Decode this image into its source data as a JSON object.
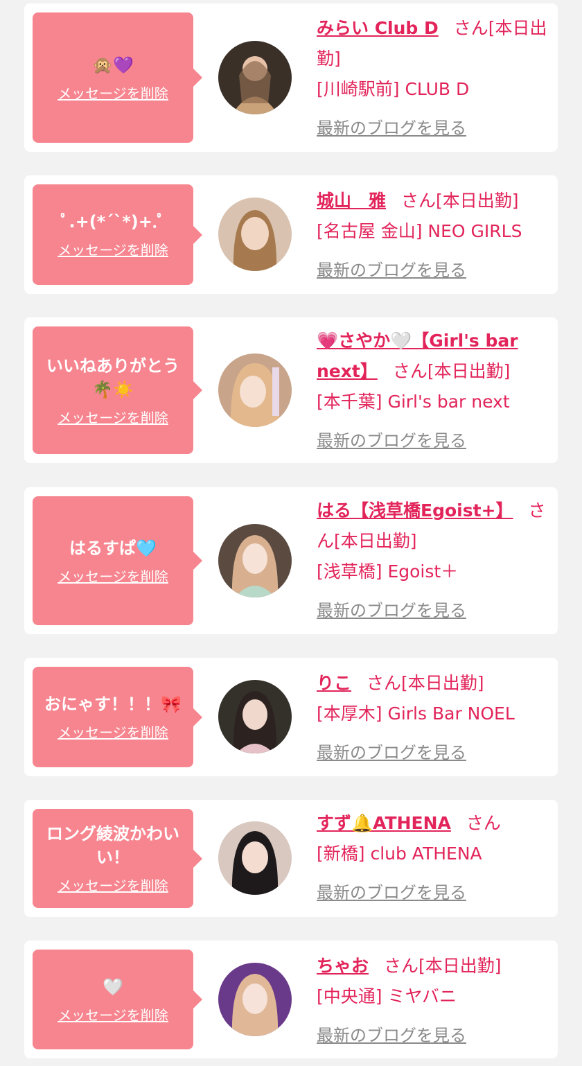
{
  "common": {
    "delete_label": "メッセージを削除",
    "blog_label": "最新のブログを見る",
    "honorific": "さん"
  },
  "colors": {
    "accent": "#e2245a",
    "bubble": "#f7858f",
    "blog_link": "#8a8a8a",
    "card": "#ffffff",
    "page": "#f2f2f3"
  },
  "items": [
    {
      "message": "🙊💜",
      "name": "みらい Club D",
      "status": "[本日出勤]",
      "shop": "[川崎駅前] CLUB D"
    },
    {
      "message": "ﾟ.+(*´`*)+.ﾟ",
      "name": "城山　雅",
      "status": "[本日出勤]",
      "shop": "[名古屋 金山] NEO GIRLS"
    },
    {
      "message": "いいねありがとう🌴☀️",
      "name": "💗さやか🤍【Girl's bar next】",
      "status": "[本日出勤]",
      "shop": "[本千葉] Girl's bar next"
    },
    {
      "message": "はるすぱ🩵",
      "name": "はる【浅草橋Egoist+】",
      "status": "[本日出勤]",
      "shop": "[浅草橋] Egoist＋"
    },
    {
      "message": "おにゃす！！！🎀",
      "name": "りこ",
      "status": "[本日出勤]",
      "shop": "[本厚木] Girls Bar NOEL"
    },
    {
      "message": "ロング綾波かわいい！",
      "name": "すず🔔ATHENA",
      "status": "",
      "shop": "[新橋] club ATHENA"
    },
    {
      "message": "🤍",
      "name": "ちゃお",
      "status": "[本日出勤]",
      "shop": "[中央通] ミヤバニ"
    }
  ]
}
